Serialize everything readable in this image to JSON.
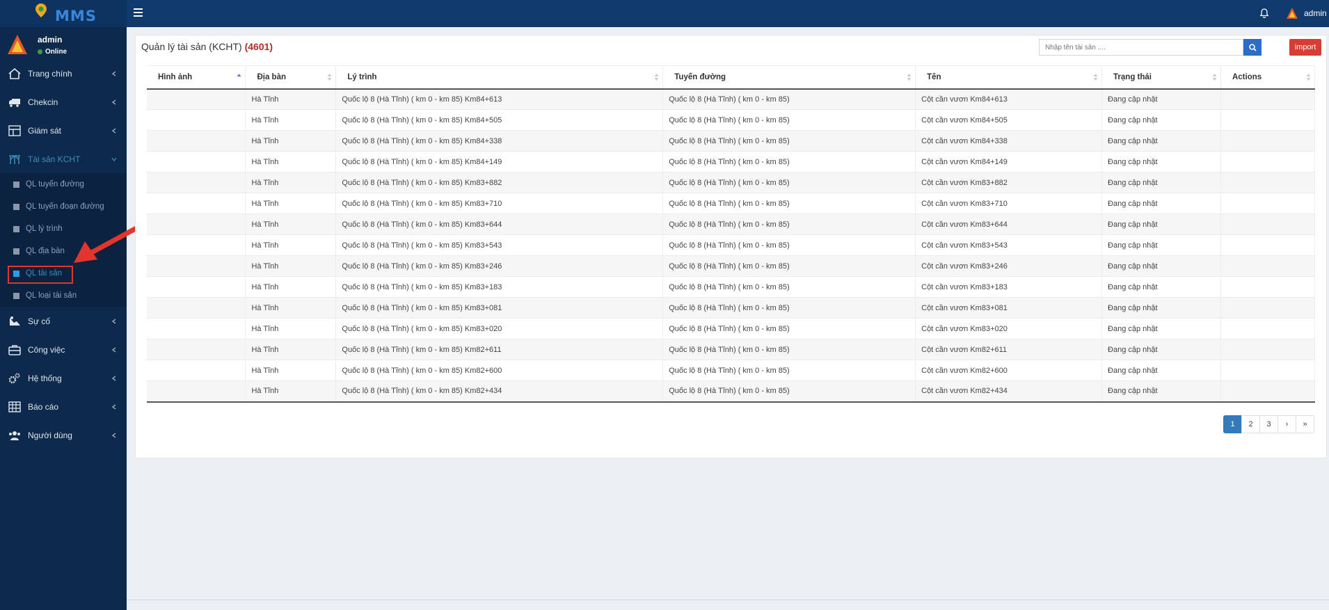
{
  "header": {
    "logo_text": "MMS",
    "user_name": "admin"
  },
  "sidebar": {
    "user": {
      "name": "admin",
      "status": "Online"
    },
    "items": [
      {
        "label": "Trang chính",
        "icon": "home-icon"
      },
      {
        "label": "Chekcin",
        "icon": "truck-icon"
      },
      {
        "label": "Giám sát",
        "icon": "monitor-icon"
      },
      {
        "label": "Tài sản KCHT",
        "icon": "infrastructure-icon"
      },
      {
        "label": "Sự cố",
        "icon": "incident-icon"
      },
      {
        "label": "Công việc",
        "icon": "briefcase-icon"
      },
      {
        "label": "Hệ thống",
        "icon": "gears-icon"
      },
      {
        "label": "Báo cáo",
        "icon": "report-icon"
      },
      {
        "label": "Người dùng",
        "icon": "users-icon"
      }
    ],
    "sub_items": [
      {
        "label": "QL tuyến đường"
      },
      {
        "label": "QL tuyến đoạn đường"
      },
      {
        "label": "QL lý trình"
      },
      {
        "label": "QL địa bàn"
      },
      {
        "label": "QL tài sản"
      },
      {
        "label": "QL loại tài sản"
      }
    ]
  },
  "main": {
    "title": "Quản lý tài sản (KCHT)",
    "count": "(4601)",
    "search_placeholder": "Nhập tên tài sản ....",
    "import_label": "import",
    "columns": [
      "Hình ảnh",
      "Địa bàn",
      "Lý trình",
      "Tuyến đường",
      "Tên",
      "Trạng thái",
      "Actions"
    ],
    "rows": [
      [
        "",
        "Hà Tĩnh",
        "Quốc lộ 8 (Hà Tĩnh) ( km 0 - km 85) Km84+613",
        "Quốc lộ 8 (Hà Tĩnh) ( km 0 - km 85)",
        "Cột cần vươn Km84+613",
        "Đang cập nhật",
        ""
      ],
      [
        "",
        "Hà Tĩnh",
        "Quốc lộ 8 (Hà Tĩnh) ( km 0 - km 85) Km84+505",
        "Quốc lộ 8 (Hà Tĩnh) ( km 0 - km 85)",
        "Cột cần vươn Km84+505",
        "Đang cập nhật",
        ""
      ],
      [
        "",
        "Hà Tĩnh",
        "Quốc lộ 8 (Hà Tĩnh) ( km 0 - km 85) Km84+338",
        "Quốc lộ 8 (Hà Tĩnh) ( km 0 - km 85)",
        "Cột cần vươn Km84+338",
        "Đang cập nhật",
        ""
      ],
      [
        "",
        "Hà Tĩnh",
        "Quốc lộ 8 (Hà Tĩnh) ( km 0 - km 85) Km84+149",
        "Quốc lộ 8 (Hà Tĩnh) ( km 0 - km 85)",
        "Cột cần vươn Km84+149",
        "Đang cập nhật",
        ""
      ],
      [
        "",
        "Hà Tĩnh",
        "Quốc lộ 8 (Hà Tĩnh) ( km 0 - km 85) Km83+882",
        "Quốc lộ 8 (Hà Tĩnh) ( km 0 - km 85)",
        "Cột cần vươn Km83+882",
        "Đang cập nhật",
        ""
      ],
      [
        "",
        "Hà Tĩnh",
        "Quốc lộ 8 (Hà Tĩnh) ( km 0 - km 85) Km83+710",
        "Quốc lộ 8 (Hà Tĩnh) ( km 0 - km 85)",
        "Cột cần vươn Km83+710",
        "Đang cập nhật",
        ""
      ],
      [
        "",
        "Hà Tĩnh",
        "Quốc lộ 8 (Hà Tĩnh) ( km 0 - km 85) Km83+644",
        "Quốc lộ 8 (Hà Tĩnh) ( km 0 - km 85)",
        "Cột cần vươn Km83+644",
        "Đang cập nhật",
        ""
      ],
      [
        "",
        "Hà Tĩnh",
        "Quốc lộ 8 (Hà Tĩnh) ( km 0 - km 85) Km83+543",
        "Quốc lộ 8 (Hà Tĩnh) ( km 0 - km 85)",
        "Cột cần vươn Km83+543",
        "Đang cập nhật",
        ""
      ],
      [
        "",
        "Hà Tĩnh",
        "Quốc lộ 8 (Hà Tĩnh) ( km 0 - km 85) Km83+246",
        "Quốc lộ 8 (Hà Tĩnh) ( km 0 - km 85)",
        "Cột cần vươn Km83+246",
        "Đang cập nhật",
        ""
      ],
      [
        "",
        "Hà Tĩnh",
        "Quốc lộ 8 (Hà Tĩnh) ( km 0 - km 85) Km83+183",
        "Quốc lộ 8 (Hà Tĩnh) ( km 0 - km 85)",
        "Cột cần vươn Km83+183",
        "Đang cập nhật",
        ""
      ],
      [
        "",
        "Hà Tĩnh",
        "Quốc lộ 8 (Hà Tĩnh) ( km 0 - km 85) Km83+081",
        "Quốc lộ 8 (Hà Tĩnh) ( km 0 - km 85)",
        "Cột cần vươn Km83+081",
        "Đang cập nhật",
        ""
      ],
      [
        "",
        "Hà Tĩnh",
        "Quốc lộ 8 (Hà Tĩnh) ( km 0 - km 85) Km83+020",
        "Quốc lộ 8 (Hà Tĩnh) ( km 0 - km 85)",
        "Cột cần vươn Km83+020",
        "Đang cập nhật",
        ""
      ],
      [
        "",
        "Hà Tĩnh",
        "Quốc lộ 8 (Hà Tĩnh) ( km 0 - km 85) Km82+611",
        "Quốc lộ 8 (Hà Tĩnh) ( km 0 - km 85)",
        "Cột cần vươn Km82+611",
        "Đang cập nhật",
        ""
      ],
      [
        "",
        "Hà Tĩnh",
        "Quốc lộ 8 (Hà Tĩnh) ( km 0 - km 85) Km82+600",
        "Quốc lộ 8 (Hà Tĩnh) ( km 0 - km 85)",
        "Cột cần vươn Km82+600",
        "Đang cập nhật",
        ""
      ],
      [
        "",
        "Hà Tĩnh",
        "Quốc lộ 8 (Hà Tĩnh) ( km 0 - km 85) Km82+434",
        "Quốc lộ 8 (Hà Tĩnh) ( km 0 - km 85)",
        "Cột cần vươn Km82+434",
        "Đang cập nhật",
        ""
      ]
    ],
    "pagination": [
      "1",
      "2",
      "3",
      "›",
      "»"
    ]
  },
  "colors": {
    "header_bg": "#0f3a6b",
    "sidebar_bg": "#0d2a4c",
    "accent": "#3c8dbc",
    "import_red": "#d73d32",
    "count_red": "#b02c28"
  }
}
